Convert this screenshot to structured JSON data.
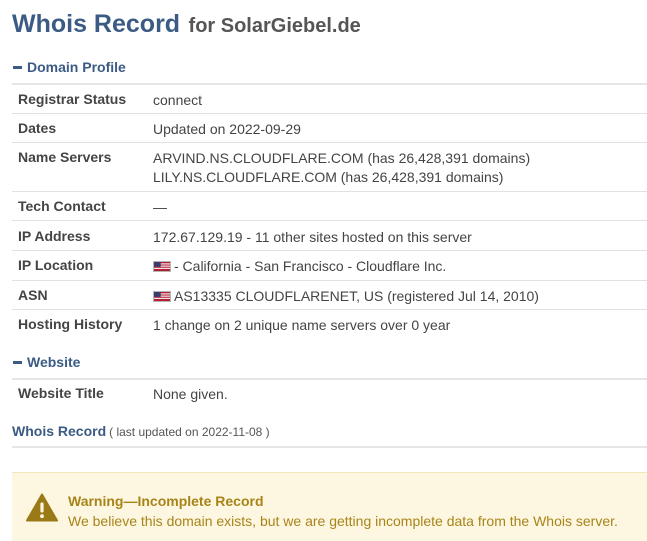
{
  "header": {
    "title": "Whois Record",
    "subtitle": "for SolarGiebel.de"
  },
  "domain_profile": {
    "heading": "Domain Profile",
    "rows": [
      {
        "label": "Registrar Status",
        "value": "connect"
      },
      {
        "label": "Dates",
        "value": "Updated on 2022-09-29"
      },
      {
        "label": "Name Servers",
        "value": "ARVIND.NS.CLOUDFLARE.COM (has 26,428,391 domains)",
        "value2": "LILY.NS.CLOUDFLARE.COM (has 26,428,391 domains)"
      },
      {
        "label": "Tech Contact",
        "value": "—"
      },
      {
        "label": "IP Address",
        "value": "172.67.129.19 - 11 other sites hosted on this server"
      },
      {
        "label": "IP Location",
        "value": "- California - San Francisco - Cloudflare Inc.",
        "flag": "us-flag-icon"
      },
      {
        "label": "ASN",
        "value": "AS13335 CLOUDFLARENET, US (registered Jul 14, 2010)",
        "flag": "us-flag-icon"
      },
      {
        "label": "Hosting History",
        "value": "1 change on 2 unique name servers over 0 year"
      }
    ]
  },
  "website": {
    "heading": "Website",
    "rows": [
      {
        "label": "Website Title",
        "value": "None given."
      }
    ]
  },
  "whois_record": {
    "label": "Whois Record",
    "updated": "( last updated on 2022-11-08 )"
  },
  "warning": {
    "icon": "warning-triangle-icon",
    "title": "Warning—Incomplete Record",
    "text": "We believe this domain exists, but we are getting incomplete data from the Whois server."
  },
  "colors": {
    "heading_blue": "#3b5b84",
    "warning_text": "#a88418",
    "warning_bg": "#fdf7e2",
    "warning_icon": "#9a7a16"
  }
}
